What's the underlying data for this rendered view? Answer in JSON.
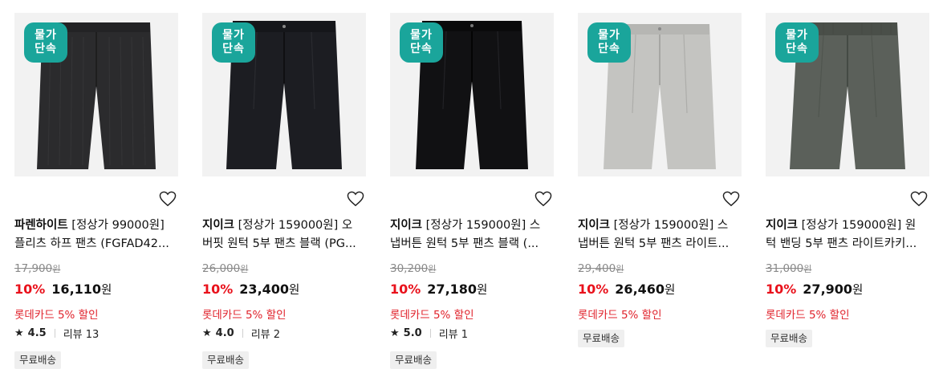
{
  "products": [
    {
      "badge": [
        "물가",
        "단속"
      ],
      "brand": "파렌하이트",
      "title_rest1": " [정상가 99000원]",
      "title_line2": "플리츠 하프 팬츠 (FGFAD42...",
      "original_price": "17,900",
      "original_unit": "원",
      "discount_rate": "10%",
      "sale_price": "16,110",
      "sale_unit": "원",
      "card_discount": "롯데카드 5% 할인",
      "rating": "4.5",
      "review_label": "리뷰 13",
      "shipping": "무료배송",
      "icon": "heart-outline-icon",
      "color": "#2b2b2d"
    },
    {
      "badge": [
        "물가",
        "단속"
      ],
      "brand": "지이크",
      "title_rest1": " [정상가 159000원] 오",
      "title_line2": "버핏 원턱 5부 팬츠 블랙 (PG...",
      "original_price": "26,000",
      "original_unit": "원",
      "discount_rate": "10%",
      "sale_price": "23,400",
      "sale_unit": "원",
      "card_discount": "롯데카드 5% 할인",
      "rating": "4.0",
      "review_label": "리뷰 2",
      "shipping": "무료배송",
      "icon": "heart-outline-icon",
      "color": "#1c1d22"
    },
    {
      "badge": [
        "물가",
        "단속"
      ],
      "brand": "지이크",
      "title_rest1": " [정상가 159000원] 스",
      "title_line2": "냅버튼 원턱 5부 팬츠 블랙 (...",
      "original_price": "30,200",
      "original_unit": "원",
      "discount_rate": "10%",
      "sale_price": "27,180",
      "sale_unit": "원",
      "card_discount": "롯데카드 5% 할인",
      "rating": "5.0",
      "review_label": "리뷰 1",
      "shipping": "무료배송",
      "icon": "heart-outline-icon",
      "color": "#111113"
    },
    {
      "badge": [
        "물가",
        "단속"
      ],
      "brand": "지이크",
      "title_rest1": " [정상가 159000원] 스",
      "title_line2": "냅버튼 원턱 5부 팬츠 라이트...",
      "original_price": "29,400",
      "original_unit": "원",
      "discount_rate": "10%",
      "sale_price": "26,460",
      "sale_unit": "원",
      "card_discount": "롯데카드 5% 할인",
      "rating": "",
      "review_label": "",
      "shipping": "무료배송",
      "icon": "heart-outline-icon",
      "color": "#c4c4c1"
    },
    {
      "badge": [
        "물가",
        "단속"
      ],
      "brand": "지이크",
      "title_rest1": " [정상가 159000원] 원",
      "title_line2": "턱 밴딩 5부 팬츠 라이트카키...",
      "original_price": "31,000",
      "original_unit": "원",
      "discount_rate": "10%",
      "sale_price": "27,900",
      "sale_unit": "원",
      "card_discount": "롯데카드 5% 할인",
      "rating": "",
      "review_label": "",
      "shipping": "무료배송",
      "icon": "heart-outline-icon",
      "color": "#5b605a"
    }
  ],
  "colors": {
    "badge": "#1aa59b",
    "discount": "#e9111b",
    "card_discount": "#e0222b"
  }
}
